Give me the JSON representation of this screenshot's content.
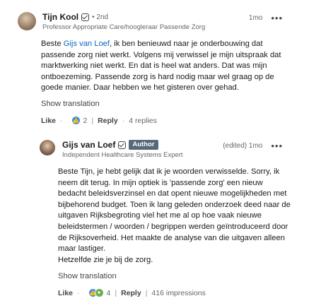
{
  "comment1": {
    "author": "Tijn Kool",
    "degree": "• 2nd",
    "headline": "Professor Appropriate Care/hoogleraar Passende Zorg",
    "time": "1mo",
    "text_pre": "Beste ",
    "mention": "Gijs van Loef",
    "text_post": ", ik ben benieuwd naar je onderbouwing dat passende zorg niet werkt. Volgens mij verwissel je mijn uitspraak dat marktwerking niet werkt. En dat is heel wat anders. Dat was mijn ontboezeming. Passende zorg is hard nodig maar wel graag op de goede manier. Daar hebben we het gisteren over gehad.",
    "show_translation": "Show translation",
    "like": "Like",
    "reactions_count": "2",
    "reply": "Reply",
    "replies": "4 replies",
    "like_icon": "thumbs-up-icon",
    "more_icon": "more-options-icon"
  },
  "comment2": {
    "author": "Gijs van Loef",
    "badge": "Author",
    "headline": "Independent Healthcare Systems Expert",
    "time": "(edited) 1mo",
    "text": "Beste Tijn, je hebt gelijk dat ik je woorden verwisselde. Sorry, ik neem dit terug. In mijn optiek is 'passende zorg' een nieuw bedacht beleidsverzinsel en dat opent nieuwe mogelijkheden met bijbehorend budget. Toen ik lang geleden onderzoek deed naar de uitgaven Rijksbegroting viel het me al op hoe vaak nieuwe beleidstermen / woorden / begrippen werden geïntroduceerd door de Rijksoverheid. Het maakte de analyse van die uitgaven alleen maar lastiger.",
    "text2": "Hetzelfde zie je bij de zorg.",
    "show_translation": "Show translation",
    "like": "Like",
    "reactions_count": "4",
    "reply": "Reply",
    "impressions": "416 impressions",
    "like_icon": "thumbs-up-icon",
    "celebrate_icon": "celebrate-icon",
    "more_icon": "more-options-icon"
  },
  "colors": {
    "link": "#0a66c2",
    "badge_bg": "#56687a",
    "like_blue": "#378fe9",
    "celebrate_green": "#6dae4f"
  }
}
